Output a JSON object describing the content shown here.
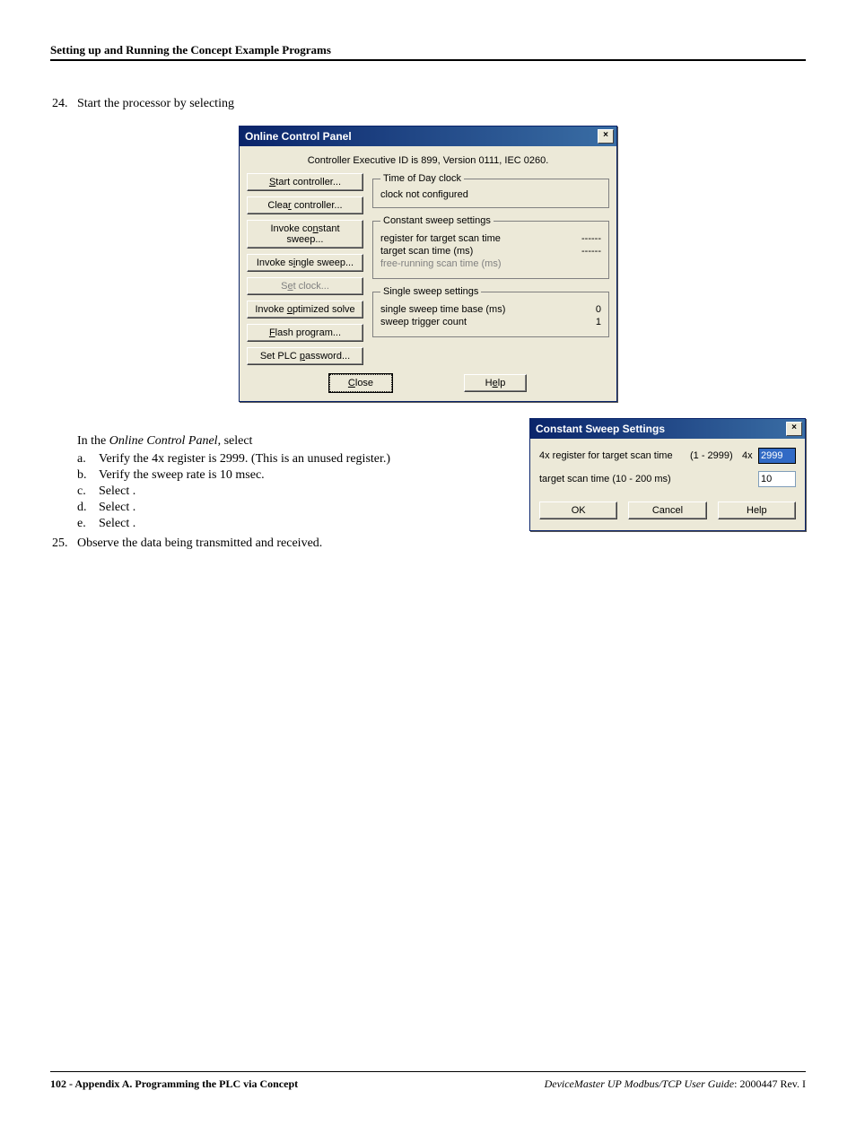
{
  "header": "Setting up and Running the Concept Example Programs",
  "step24": {
    "num": "24.",
    "text": "Start the processor by selecting"
  },
  "dialog1": {
    "title": "Online Control Panel",
    "controller_id": "Controller Executive ID is 899, Version 0111, IEC 0260.",
    "buttons": {
      "start": "Start controller...",
      "clear": "Clear controller...",
      "invoke_const": "Invoke constant sweep...",
      "invoke_single": "Invoke single sweep...",
      "set_clock": "Set clock...",
      "invoke_opt": "Invoke optimized solve",
      "flash": "Flash program...",
      "set_pwd": "Set PLC password..."
    },
    "groups": {
      "tod": {
        "legend": "Time of Day clock",
        "line1": "clock not configured"
      },
      "const": {
        "legend": "Constant sweep settings",
        "r1k": "register for target scan time",
        "r1v": "------",
        "r2k": "target scan time (ms)",
        "r2v": "------",
        "r3k": "free-running scan time (ms)"
      },
      "single": {
        "legend": "Single sweep settings",
        "r1k": "single sweep time base (ms)",
        "r1v": "0",
        "r2k": "sweep trigger count",
        "r2v": "1"
      }
    },
    "footer_btns": {
      "close": "Close",
      "help": "Help"
    }
  },
  "instructions": {
    "intro_pre": "In the ",
    "intro_em": "Online Control Panel",
    "intro_post": ", select",
    "a": "Verify the 4x register is 2999. (This is an unused register.)",
    "b": "Verify the sweep rate is 10 msec.",
    "c": "Select       .",
    "d": "Select                  .",
    "e": "Select       ."
  },
  "step25": {
    "num": "25.",
    "text": "Observe the data being transmitted and received."
  },
  "dialog2": {
    "title": "Constant Sweep Settings",
    "row1": {
      "label": "4x register for target scan time",
      "range": "(1 - 2999)",
      "prefix": "4x",
      "value": "2999"
    },
    "row2": {
      "label": "target scan time (10 - 200 ms)",
      "value": "10"
    },
    "buttons": {
      "ok": "OK",
      "cancel": "Cancel",
      "help": "Help"
    }
  },
  "footer": {
    "left": "102 - Appendix A. Programming the PLC via Concept",
    "right_em": "DeviceMaster UP Modbus/TCP User Guide",
    "right_plain": ": 2000447 Rev. I"
  }
}
